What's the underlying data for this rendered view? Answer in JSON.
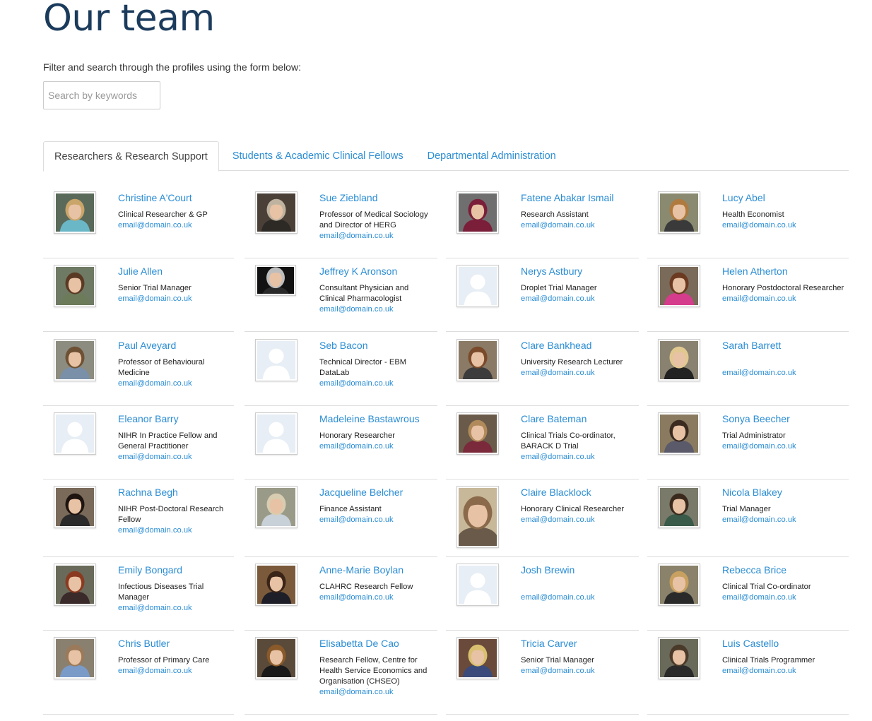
{
  "page": {
    "title": "Our team",
    "intro": "Filter and search through the profiles using the form below:",
    "search_placeholder": "Search by keywords"
  },
  "tabs": [
    {
      "label": "Researchers & Research Support",
      "active": true
    },
    {
      "label": "Students & Academic Clinical Fellows",
      "active": false
    },
    {
      "label": "Departmental Administration",
      "active": false
    }
  ],
  "colors": {
    "title": "#1b3b5c",
    "link": "#2a8dd4",
    "border": "#dddddd",
    "placeholder_avatar": "#e7eef5"
  },
  "people": [
    {
      "name": "Christine A'Court",
      "role": "Clinical Researcher & GP",
      "email": "email@domain.co.uk",
      "photo": true,
      "hair": "#c9a56a",
      "bg": "#5a6a5a",
      "shirt": "#6ab7c8"
    },
    {
      "name": "Sue Ziebland",
      "role": "Professor of Medical Sociology and Director of HERG",
      "email": "email@domain.co.uk",
      "photo": true,
      "hair": "#bfb3a0",
      "bg": "#4a4038",
      "shirt": "#2d2a26"
    },
    {
      "name": "Fatene Abakar Ismail",
      "role": "Research Assistant",
      "email": "email@domain.co.uk",
      "photo": true,
      "hair": "#7a1e3a",
      "bg": "#6f6f6f",
      "shirt": "#7a1e3a"
    },
    {
      "name": "Lucy Abel",
      "role": "Health Economist",
      "email": "email@domain.co.uk",
      "photo": true,
      "hair": "#b07a3f",
      "bg": "#8a8a70",
      "shirt": "#3a3a3a"
    },
    {
      "name": "Julie Allen",
      "role": "Senior Trial Manager",
      "email": "email@domain.co.uk",
      "photo": true,
      "hair": "#5a3a24",
      "bg": "#6f7a64",
      "shirt": "#6c7b5a"
    },
    {
      "name": "Jeffrey K Aronson",
      "role": "Consultant Physician and Clinical Pharmacologist",
      "email": "email@domain.co.uk",
      "photo": true,
      "hair": "#bdbdbd",
      "bg": "#121212",
      "shirt": "#2a2a2a"
    },
    {
      "name": "Nerys Astbury",
      "role": "Droplet Trial Manager",
      "email": "email@domain.co.uk",
      "photo": false
    },
    {
      "name": "Helen Atherton",
      "role": "Honorary Postdoctoral Researcher",
      "email": "email@domain.co.uk",
      "photo": true,
      "hair": "#6b3a20",
      "bg": "#7a6a5a",
      "shirt": "#d63c8c"
    },
    {
      "name": "Paul Aveyard",
      "role": "Professor of Behavioural Medicine",
      "email": "email@domain.co.uk",
      "photo": true,
      "hair": "#6e5134",
      "bg": "#8c8c80",
      "shirt": "#7a8fa8"
    },
    {
      "name": "Seb Bacon",
      "role": "Technical Director - EBM DataLab",
      "email": "email@domain.co.uk",
      "photo": false
    },
    {
      "name": "Clare Bankhead",
      "role": "University Research Lecturer",
      "email": "email@domain.co.uk",
      "photo": true,
      "hair": "#7a4a2a",
      "bg": "#8a7a66",
      "shirt": "#3c3c3c"
    },
    {
      "name": "Sarah Barrett",
      "role": "",
      "email": "email@domain.co.uk",
      "photo": true,
      "hair": "#e0c890",
      "bg": "#8a8270",
      "shirt": "#222222"
    },
    {
      "name": "Eleanor Barry",
      "role": "NIHR In Practice Fellow and General Practitioner",
      "email": "email@domain.co.uk",
      "photo": false
    },
    {
      "name": "Madeleine Bastawrous",
      "role": "Honorary Researcher",
      "email": "email@domain.co.uk",
      "photo": false
    },
    {
      "name": "Clare Bateman",
      "role": "Clinical Trials Co-ordinator, BARACK D Trial",
      "email": "email@domain.co.uk",
      "photo": true,
      "hair": "#b08a5a",
      "bg": "#6a5a4a",
      "shirt": "#7a2a3a"
    },
    {
      "name": "Sonya Beecher",
      "role": "Trial Administrator",
      "email": "email@domain.co.uk",
      "photo": true,
      "hair": "#3a2a20",
      "bg": "#8a7a60",
      "shirt": "#5a5a6a"
    },
    {
      "name": "Rachna Begh",
      "role": "NIHR Post-Doctoral Research Fellow",
      "email": "email@domain.co.uk",
      "photo": true,
      "hair": "#1e1410",
      "bg": "#7a6a5a",
      "shirt": "#2a2a2a"
    },
    {
      "name": "Jacqueline Belcher",
      "role": "Finance Assistant",
      "email": "email@domain.co.uk",
      "photo": true,
      "hair": "#d8cdb0",
      "bg": "#9a9a88",
      "shirt": "#c8d0d8"
    },
    {
      "name": "Claire Blacklock",
      "role": "Honorary Clinical Researcher",
      "email": "email@domain.co.uk",
      "photo": true,
      "hair": "#8a6a4a",
      "bg": "#c8b89a",
      "shirt": "#6a5a4a"
    },
    {
      "name": "Nicola Blakey",
      "role": "Trial Manager",
      "email": "email@domain.co.uk",
      "photo": true,
      "hair": "#3a2a1e",
      "bg": "#7a7a6a",
      "shirt": "#3a5a4a"
    },
    {
      "name": "Emily Bongard",
      "role": "Infectious Diseases Trial Manager",
      "email": "email@domain.co.uk",
      "photo": true,
      "hair": "#8a3a20",
      "bg": "#6a6a5a",
      "shirt": "#3a2a2a"
    },
    {
      "name": "Anne-Marie Boylan",
      "role": "CLAHRC Research Fellow",
      "email": "email@domain.co.uk",
      "photo": true,
      "hair": "#3a2418",
      "bg": "#7a5a3a",
      "shirt": "#1e1e28"
    },
    {
      "name": "Josh Brewin",
      "role": "",
      "email": "email@domain.co.uk",
      "photo": false
    },
    {
      "name": "Rebecca Brice",
      "role": "Clinical Trial Co-ordinator",
      "email": "email@domain.co.uk",
      "photo": true,
      "hair": "#c8a060",
      "bg": "#8a826a",
      "shirt": "#2a2a2a"
    },
    {
      "name": "Chris Butler",
      "role": "Professor of Primary Care",
      "email": "email@domain.co.uk",
      "photo": true,
      "hair": "#9a7a5a",
      "bg": "#8a8070",
      "shirt": "#7a9ac8"
    },
    {
      "name": "Elisabetta De Cao",
      "role": "Research Fellow, Centre for Health Service Economics and Organisation (CHSEO)",
      "email": "email@domain.co.uk",
      "photo": true,
      "hair": "#8a5a2a",
      "bg": "#5a4a3a",
      "shirt": "#1a1a1a"
    },
    {
      "name": "Tricia Carver",
      "role": "Senior Trial Manager",
      "email": "email@domain.co.uk",
      "photo": true,
      "hair": "#d8c070",
      "bg": "#6a4a3a",
      "shirt": "#3a4a7a"
    },
    {
      "name": "Luis Castello",
      "role": "Clinical Trials Programmer",
      "email": "email@domain.co.uk",
      "photo": true,
      "hair": "#4a3a2a",
      "bg": "#6a6a5a",
      "shirt": "#2a2a2a"
    }
  ]
}
